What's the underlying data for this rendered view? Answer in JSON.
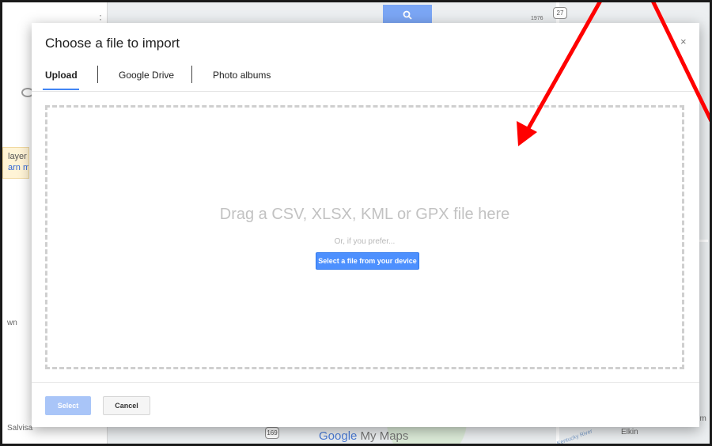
{
  "map": {
    "layer_text": "layer",
    "learn_more": "arn m",
    "label_salvisa": "Salvisa",
    "label_own": "wn",
    "label_elkin": "Elkin",
    "label_em": "em",
    "route_27": "27",
    "route_169": "169",
    "route_1976": "1976",
    "logo_google": "Google",
    "logo_mymaps": " My Maps",
    "river_label": "Kentucky River"
  },
  "dialog": {
    "title": "Choose a file to import",
    "close_label": "×",
    "tabs": [
      {
        "label": "Upload",
        "active": true
      },
      {
        "label": "Google Drive",
        "active": false
      },
      {
        "label": "Photo albums",
        "active": false
      }
    ],
    "drop_text": "Drag a CSV, XLSX, KML or GPX file here",
    "prefer_text": "Or, if you prefer...",
    "select_device_label": "Select a file from your device",
    "select_label": "Select",
    "cancel_label": "Cancel"
  },
  "colors": {
    "accent": "#4285f4",
    "button_blue": "#4d90fe",
    "disabled_blue": "#a9c5f8",
    "annotation_red": "#ff0000"
  }
}
